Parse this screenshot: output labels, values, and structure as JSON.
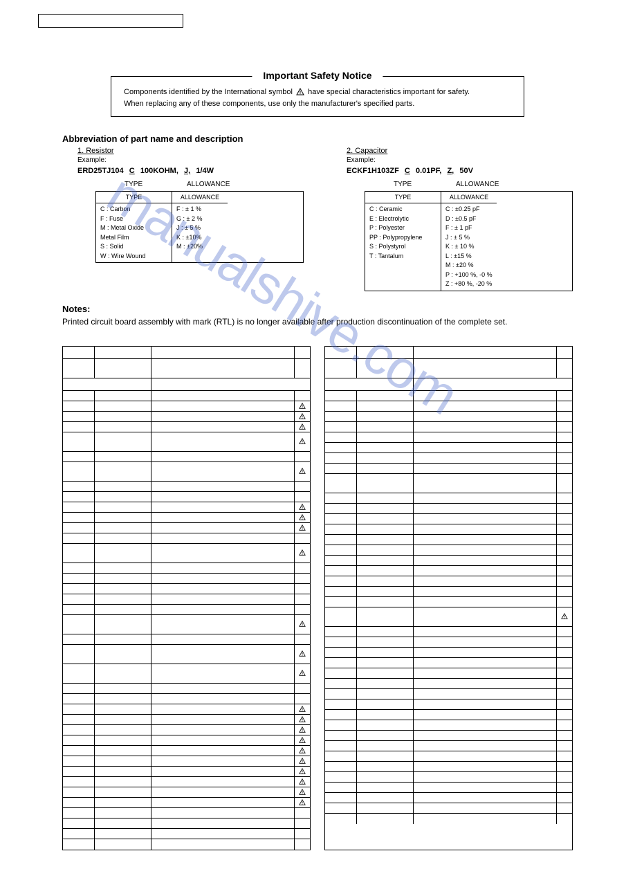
{
  "safety": {
    "title": "Important Safety Notice",
    "line1a": "Components identified by the International symbol ",
    "line1b": " have special characteristics important for safety.",
    "line2": "When replacing any of these components, use only the manufacturer's specified parts."
  },
  "section_title": "Abbreviation of part name and description",
  "resistor": {
    "header": "1.  Resistor",
    "example_label": "Example:",
    "part": "ERD25TJ104",
    "type_letter": "C",
    "mid": "100KOHM,",
    "allow_letter": "J,",
    "tail": "1/4W",
    "label_type": "TYPE",
    "label_allow": "ALLOWANCE",
    "table_hdr_type": "TYPE",
    "table_hdr_allow": "ALLOWANCE",
    "types": [
      "C  :  Carbon",
      "F  :  Fuse",
      "M :  Metal Oxide",
      "       Metal Film",
      "S  :  Solid",
      "W :  Wire Wound"
    ],
    "allows": [
      "F  :  ± 1 %",
      "G :  ± 2 %",
      "J  :  ± 5 %",
      "K :  ±10%",
      "M :  ±20%"
    ]
  },
  "capacitor": {
    "header": "2.  Capacitor",
    "example_label": "Example:",
    "part": "ECKF1H103ZF",
    "type_letter": "C",
    "mid": "0.01PF,",
    "allow_letter": "Z,",
    "tail": "50V",
    "label_type": "TYPE",
    "label_allow": "ALLOWANCE",
    "table_hdr_type": "TYPE",
    "table_hdr_allow": "ALLOWANCE",
    "types": [
      "C   :  Ceramic",
      "E   :  Electrolytic",
      "P   :  Polyester",
      "PP :  Polypropylene",
      "S   :  Polystyrol",
      "T   :  Tantalum"
    ],
    "allows": [
      "C :  ±0.25 pF",
      "D :  ±0.5 pF",
      "F :  ± 1 pF",
      "J  :  ±  5 %",
      "K :  ± 10 %",
      "L :  ±15 %",
      "M :  ±20 %",
      "P :  +100 %, -0 %",
      "Z :  +80 %, -20 %"
    ]
  },
  "notes": {
    "heading": "Notes:",
    "text": "Printed circuit board assembly with mark (RTL) is no longer available after production discontinuation of the complete set."
  },
  "watermark": "manualshive.com",
  "left_rows": [
    {
      "h": "hdr"
    },
    {
      "h": "tall"
    },
    {
      "mergehdr": true
    },
    {},
    {
      "w": true
    },
    {
      "w": true
    },
    {
      "w": true
    },
    {
      "h": "tall",
      "w": true
    },
    {},
    {
      "h": "tall",
      "w": true
    },
    {},
    {},
    {
      "w": true
    },
    {
      "w": true
    },
    {
      "w": true
    },
    {},
    {
      "h": "tall",
      "w": true
    },
    {},
    {},
    {},
    {},
    {},
    {
      "h": "tall",
      "w": true
    },
    {},
    {
      "h": "tall",
      "w": true
    },
    {
      "h": "tall",
      "w": true
    },
    {},
    {},
    {
      "w": true
    },
    {
      "w": true
    },
    {
      "w": true
    },
    {
      "w": true
    },
    {
      "w": true
    },
    {
      "w": true
    },
    {
      "w": true
    },
    {
      "w": true
    },
    {
      "w": true
    },
    {
      "w": true
    },
    {},
    {},
    {},
    {}
  ],
  "right_rows": [
    {
      "h": "hdr"
    },
    {
      "h": "tall"
    },
    {
      "mergehdr": true
    },
    {},
    {},
    {},
    {},
    {},
    {},
    {},
    {},
    {
      "h": "tall"
    },
    {},
    {},
    {},
    {},
    {},
    {},
    {},
    {},
    {},
    {},
    {},
    {
      "h": "tall",
      "w": true
    },
    {},
    {},
    {},
    {},
    {},
    {},
    {},
    {},
    {},
    {},
    {},
    {},
    {},
    {},
    {},
    {},
    {},
    {},
    {}
  ]
}
